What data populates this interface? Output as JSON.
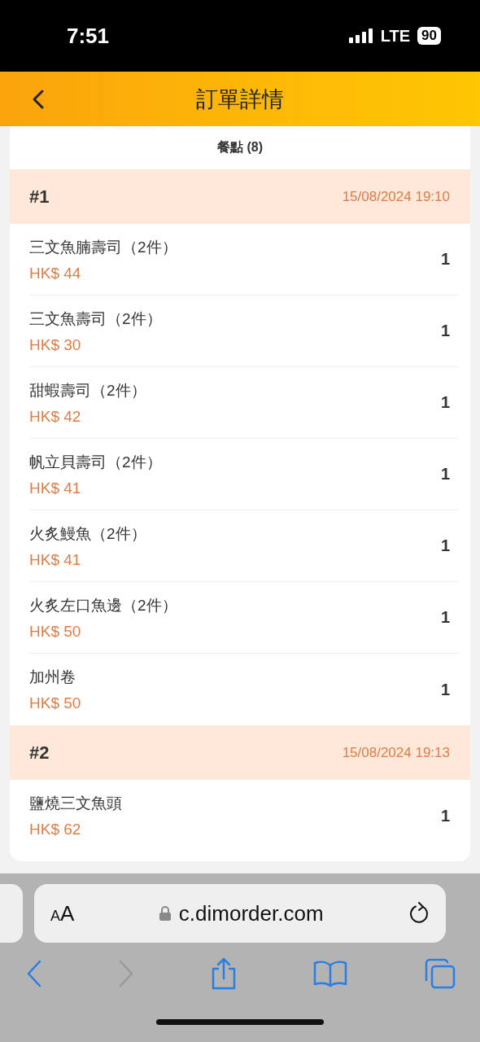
{
  "status_bar": {
    "time": "7:51",
    "network": "LTE",
    "battery": "90"
  },
  "header": {
    "title": "訂單詳情"
  },
  "section": {
    "title": "餐點 (8)"
  },
  "orders": [
    {
      "number": "#1",
      "time": "15/08/2024 19:10",
      "items": [
        {
          "name": "三文魚腩壽司（2件）",
          "price": "HK$ 44",
          "qty": "1"
        },
        {
          "name": "三文魚壽司（2件）",
          "price": "HK$ 30",
          "qty": "1"
        },
        {
          "name": "甜蝦壽司（2件）",
          "price": "HK$ 42",
          "qty": "1"
        },
        {
          "name": "帆立貝壽司（2件）",
          "price": "HK$ 41",
          "qty": "1"
        },
        {
          "name": "火炙鰻魚（2件）",
          "price": "HK$ 41",
          "qty": "1"
        },
        {
          "name": "火炙左口魚邊（2件）",
          "price": "HK$ 50",
          "qty": "1"
        },
        {
          "name": "加州卷",
          "price": "HK$ 50",
          "qty": "1"
        }
      ]
    },
    {
      "number": "#2",
      "time": "15/08/2024 19:13",
      "items": [
        {
          "name": "鹽燒三文魚頭",
          "price": "HK$ 62",
          "qty": "1"
        }
      ]
    }
  ],
  "browser": {
    "text_size": "AA",
    "url": "c.dimorder.com",
    "toolbar": [
      {
        "kind": "back",
        "disabled": false
      },
      {
        "kind": "forward",
        "disabled": true
      },
      {
        "kind": "share",
        "disabled": false
      },
      {
        "kind": "bookmarks",
        "disabled": false
      },
      {
        "kind": "tabs",
        "disabled": false
      }
    ]
  }
}
